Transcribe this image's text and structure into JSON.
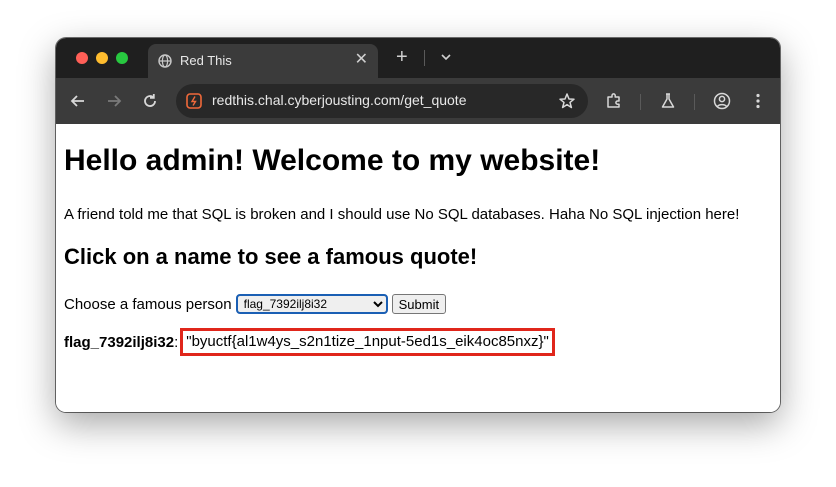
{
  "browser": {
    "tab_title": "Red This",
    "tab_close": "✕",
    "new_tab": "+",
    "url": "redthis.chal.cyberjousting.com/get_quote"
  },
  "colors": {
    "highlight_box": "#e0261b",
    "tab_bg": "#3b3b3b",
    "strip_bg": "#1f1f1f"
  },
  "page": {
    "heading": "Hello admin! Welcome to my website!",
    "intro": "A friend told me that SQL is broken and I should use No SQL databases. Haha No SQL injection here!",
    "subheading": "Click on a name to see a famous quote!",
    "form": {
      "label": "Choose a famous person",
      "selected": "flag_7392ilj8i32",
      "submit_label": "Submit"
    },
    "result": {
      "name": "flag_7392ilj8i32",
      "separator": ":",
      "quote": "\"byuctf{al1w4ys_s2n1tize_1nput-5ed1s_eik4oc85nxz}\""
    }
  }
}
